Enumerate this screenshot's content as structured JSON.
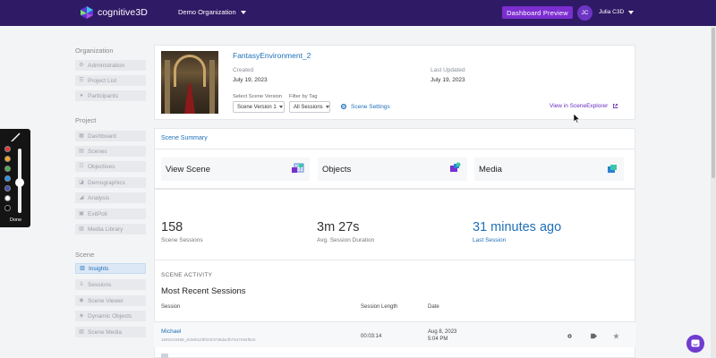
{
  "topbar": {
    "logo_text": "cognitive3D",
    "org_label": "Demo Organization",
    "dashboard_button": "Dashboard Preview",
    "avatar_initials": "JC",
    "user_name": "Julia C3D"
  },
  "sidebar": {
    "organization_header": "Organization",
    "organization_items": [
      "Administration",
      "Project List",
      "Participants"
    ],
    "project_header": "Project",
    "project_items": [
      "Dashboard",
      "Scenes",
      "Objectives",
      "Demographics",
      "Analysis",
      "ExitPoll",
      "Media Library"
    ],
    "scene_header": "Scene",
    "scene_items": [
      "Insights",
      "Sessions",
      "Scene Viewer",
      "Dynamic Objects",
      "Scene Media"
    ],
    "active_item": "Insights"
  },
  "scene": {
    "name": "FantasyEnvironment_2",
    "created_label": "Created",
    "created_value": "July 19, 2023",
    "updated_label": "Last Updated",
    "updated_value": "July 19, 2023",
    "version_label": "Select Scene Version",
    "version_value": "Scene Version 1",
    "tag_label": "Filter by Tag",
    "tag_value": "All Sessions",
    "settings_link": "Scene Settings",
    "explorer_link": "View in SceneExplorer"
  },
  "summary": {
    "title": "Scene Summary",
    "tiles": [
      "View Scene",
      "Objects",
      "Media"
    ]
  },
  "stats": {
    "sessions_value": "158",
    "sessions_label": "Scene Sessions",
    "duration_value": "3m 27s",
    "duration_label": "Avg. Session Duration",
    "last_value": "31 minutes ago",
    "last_label": "Last Session"
  },
  "activity": {
    "heading": "SCENE ACTIVITY",
    "title": "Most Recent Sessions",
    "columns": [
      "Session",
      "Session Length",
      "Date"
    ],
    "rows": [
      {
        "name": "Michael",
        "id": "1691519489_dc9eb129f2023735dacfb7647e84f642",
        "length": "00:03:14",
        "date": "Aug 8, 2023",
        "time": "5:04 PM"
      }
    ]
  },
  "palette": {
    "done_label": "Done",
    "colors": [
      "#e53935",
      "#f5a623",
      "#4caf50",
      "#2196f3",
      "#3f51b5",
      "#ffffff",
      "#000000"
    ]
  },
  "colors": {
    "topbar": "#2f1a66",
    "accent_purple": "#7c2ed0",
    "link_blue": "#1f6fb8"
  }
}
